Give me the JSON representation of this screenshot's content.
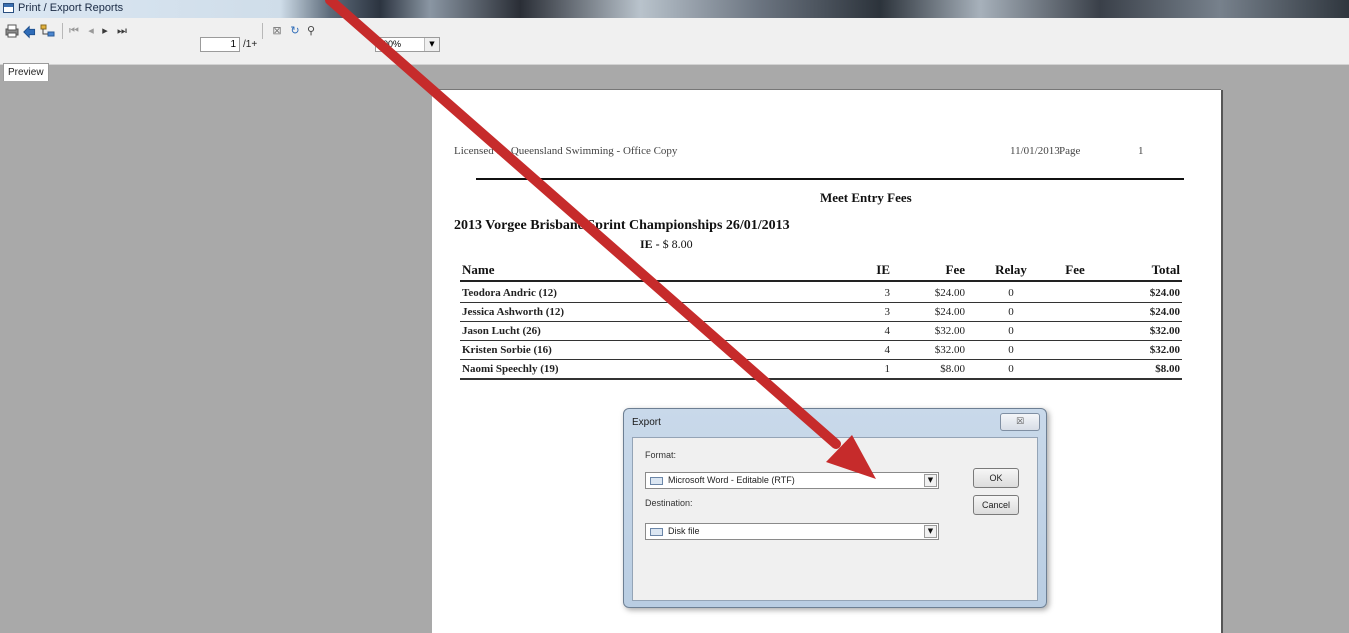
{
  "window": {
    "title": "Print / Export Reports"
  },
  "toolbar": {
    "page_current": "1",
    "page_total": "/1+",
    "zoom": "100%",
    "tab_preview": "Preview",
    "icons": [
      "print-icon",
      "export-icon",
      "tree-icon",
      "first-page-icon",
      "prev-page-icon",
      "next-page-icon",
      "last-page-icon",
      "close-current-view-icon",
      "refresh-icon",
      "search-icon"
    ]
  },
  "report": {
    "header_left": "Licensed to: Queensland Swimming - Office Copy",
    "header_date": "11/01/2013",
    "header_page_label": "Page",
    "header_page_num": "1",
    "title": "Meet Entry Fees",
    "meet_name": "2013 Vorgee Brisbane Sprint Championships  26/01/2013",
    "ie_label": "IE -",
    "ie_fee": "$ 8.00",
    "columns": {
      "name": "Name",
      "ie": "IE",
      "fee": "Fee",
      "relay": "Relay",
      "fee2": "Fee",
      "total": "Total"
    },
    "rows": [
      {
        "name": "Teodora Andric (12)",
        "ie": "3",
        "fee": "$24.00",
        "relay": "0",
        "fee2": "",
        "total": "$24.00"
      },
      {
        "name": "Jessica Ashworth (12)",
        "ie": "3",
        "fee": "$24.00",
        "relay": "0",
        "fee2": "",
        "total": "$24.00"
      },
      {
        "name": "Jason Lucht (26)",
        "ie": "4",
        "fee": "$32.00",
        "relay": "0",
        "fee2": "",
        "total": "$32.00"
      },
      {
        "name": "Kristen Sorbie (16)",
        "ie": "4",
        "fee": "$32.00",
        "relay": "0",
        "fee2": "",
        "total": "$32.00"
      },
      {
        "name": "Naomi Speechly (19)",
        "ie": "1",
        "fee": "$8.00",
        "relay": "0",
        "fee2": "",
        "total": "$8.00"
      }
    ]
  },
  "dialog": {
    "title": "Export",
    "close_glyph": "☒",
    "format_label": "Format:",
    "format_value": "Microsoft Word - Editable (RTF)",
    "destination_label": "Destination:",
    "destination_value": "Disk file",
    "ok_label": "OK",
    "cancel_label": "Cancel"
  },
  "annotation": {
    "arrow_color": "#c62b2b"
  }
}
